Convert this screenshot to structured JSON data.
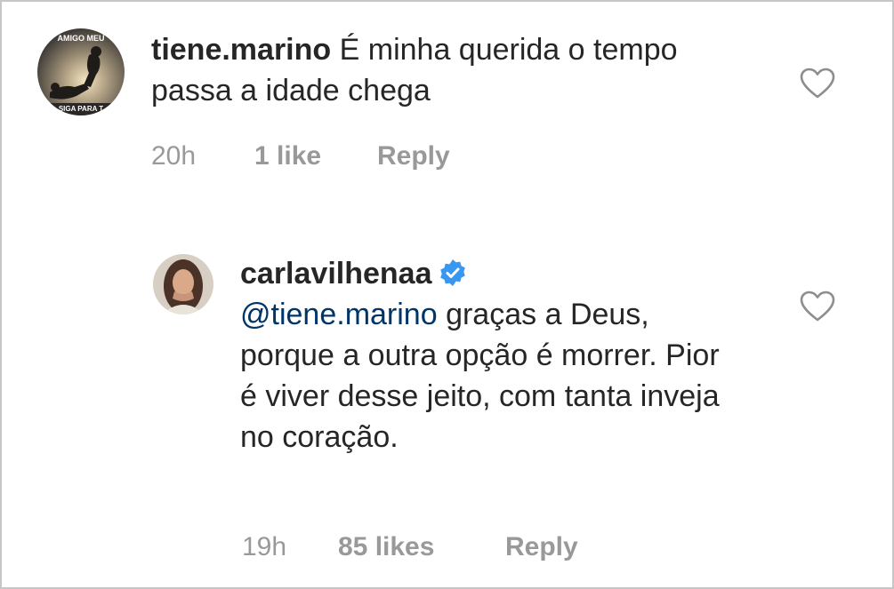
{
  "comments": [
    {
      "username": "tiene.marino",
      "text": "É minha querida o tempo passa a idade chega",
      "time": "20h",
      "likes": "1 like",
      "reply": "Reply",
      "avatar_icon": "profile-photo-silhouette",
      "avatar_text_top": "AMIGO MEU",
      "avatar_text_bottom": "SIGA PARA T",
      "verified": false
    },
    {
      "username": "carlavilhenaa",
      "mention": "@tiene.marino",
      "text_line1": " graças a",
      "text_rest": "Deus, porque a outra opção é morrer. Pior é viver desse jeito, com tanta inveja no coração.",
      "time": "19h",
      "likes": "85 likes",
      "reply": "Reply",
      "avatar_icon": "profile-photo-woman",
      "verified": true,
      "verified_color": "#3897f0"
    }
  ],
  "like_icon": "heart-outline-icon"
}
